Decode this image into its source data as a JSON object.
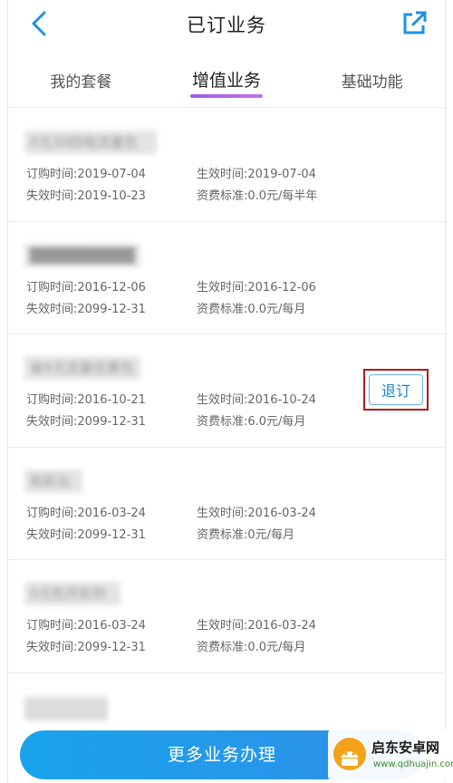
{
  "header": {
    "title": "已订业务"
  },
  "tabs": [
    {
      "label": "我的套餐"
    },
    {
      "label": "增值业务"
    },
    {
      "label": "基础功能"
    }
  ],
  "orders": [
    {
      "name": "0元30回电流量包",
      "order_time": "订购时间:2019-07-04",
      "effect_time": "生效时间:2019-07-04",
      "expire_time": "失效时间:2019-10-23",
      "fee": "资费标准:0.0元/每半年"
    },
    {
      "name": "██████████",
      "order_time": "订购时间:2016-12-06",
      "effect_time": "生效时间:2016-12-06",
      "expire_time": "失效时间:2099-12-31",
      "fee": "资费标准:0.0元/每月"
    },
    {
      "name": "省6元流量优惠包",
      "order_time": "订购时间:2016-10-21",
      "effect_time": "生效时间:2016-10-24",
      "expire_time": "失效时间:2099-12-31",
      "fee": "资费标准:6.0元/每月",
      "action": "退订"
    },
    {
      "name": "和彩云",
      "order_time": "订购时间:2016-03-24",
      "effect_time": "生效时间:2016-03-24",
      "expire_time": "失效时间:2099-12-31",
      "fee": "资费标准:0元/每月"
    },
    {
      "name": "0元包月彩铃",
      "order_time": "订购时间:2016-03-24",
      "effect_time": "生效时间:2016-03-24",
      "expire_time": "失效时间:2099-12-31",
      "fee": "资费标准:0.0元/每月"
    }
  ],
  "bottom_button": {
    "label": "更多业务办理"
  },
  "watermark": {
    "name": "启东安卓网",
    "url": "www.qdhuajin.com"
  },
  "colors": {
    "accent_blue": "#1e82d2",
    "tab_underline": "#b06ae6",
    "button_gradient_start": "#1aa3ec",
    "highlight_border": "#b11a1a"
  }
}
